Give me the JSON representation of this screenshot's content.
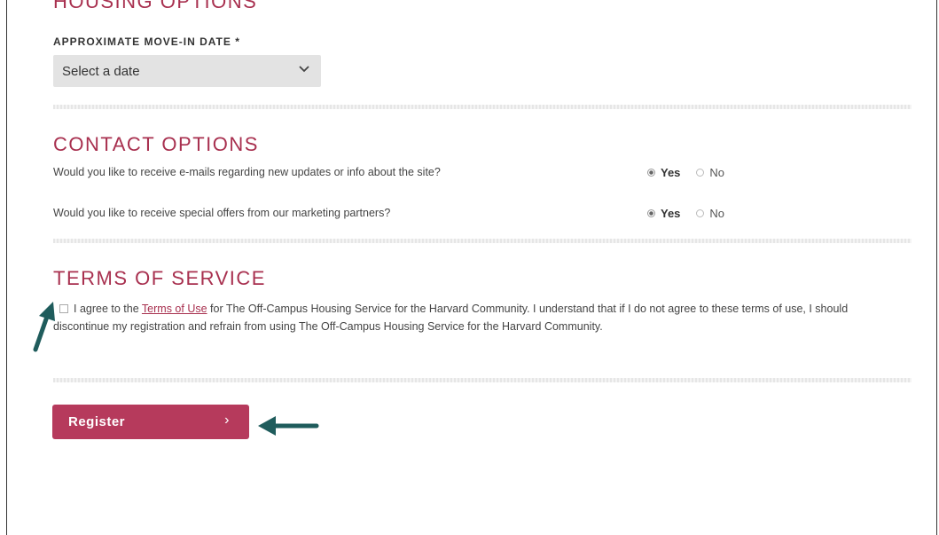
{
  "housing": {
    "title": "HOUSING OPTIONS",
    "move_in_label": "APPROXIMATE MOVE-IN DATE *",
    "move_in_value": "Select a date"
  },
  "contact": {
    "title": "CONTACT OPTIONS",
    "questions": [
      {
        "text": "Would you like to receive e-mails regarding new updates or info about the site?",
        "yes": "Yes",
        "no": "No",
        "selected": "Yes"
      },
      {
        "text": "Would you like to receive special offers from our marketing partners?",
        "yes": "Yes",
        "no": "No",
        "selected": "Yes"
      }
    ]
  },
  "terms": {
    "title": "TERMS OF SERVICE",
    "text_before_link": "I agree to the ",
    "link_text": "Terms of Use",
    "text_after_link": " for The Off-Campus Housing Service for the Harvard Community. I understand that if I do not agree to these terms of use, I should discontinue my registration and refrain from using The Off-Campus Housing Service for the Harvard Community."
  },
  "register": {
    "label": "Register",
    "arrow": "›"
  },
  "colors": {
    "accent": "#a8304f",
    "button": "#b63a5c",
    "annotation_arrow": "#1f5c5c"
  }
}
